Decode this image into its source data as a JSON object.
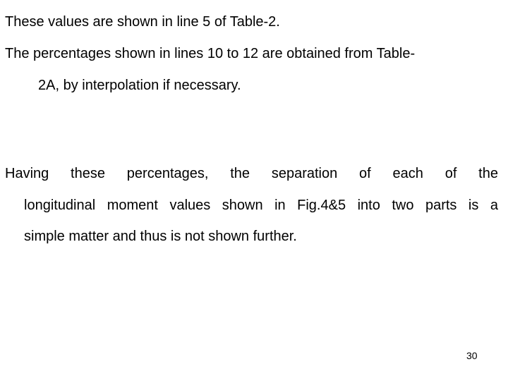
{
  "paragraphs": [
    {
      "lines": [
        "These values are shown in line 5 of Table-2."
      ]
    },
    {
      "lines": [
        "The percentages shown in lines 10 to 12 are obtained from Table-",
        "2A, by interpolation if necessary."
      ]
    },
    {
      "lines": [
        "Having these percentages, the separation of each of the",
        "longitudinal moment values shown in Fig.4&5 into two parts is a",
        "simple matter and thus is not shown further."
      ]
    }
  ],
  "page_number": "30"
}
